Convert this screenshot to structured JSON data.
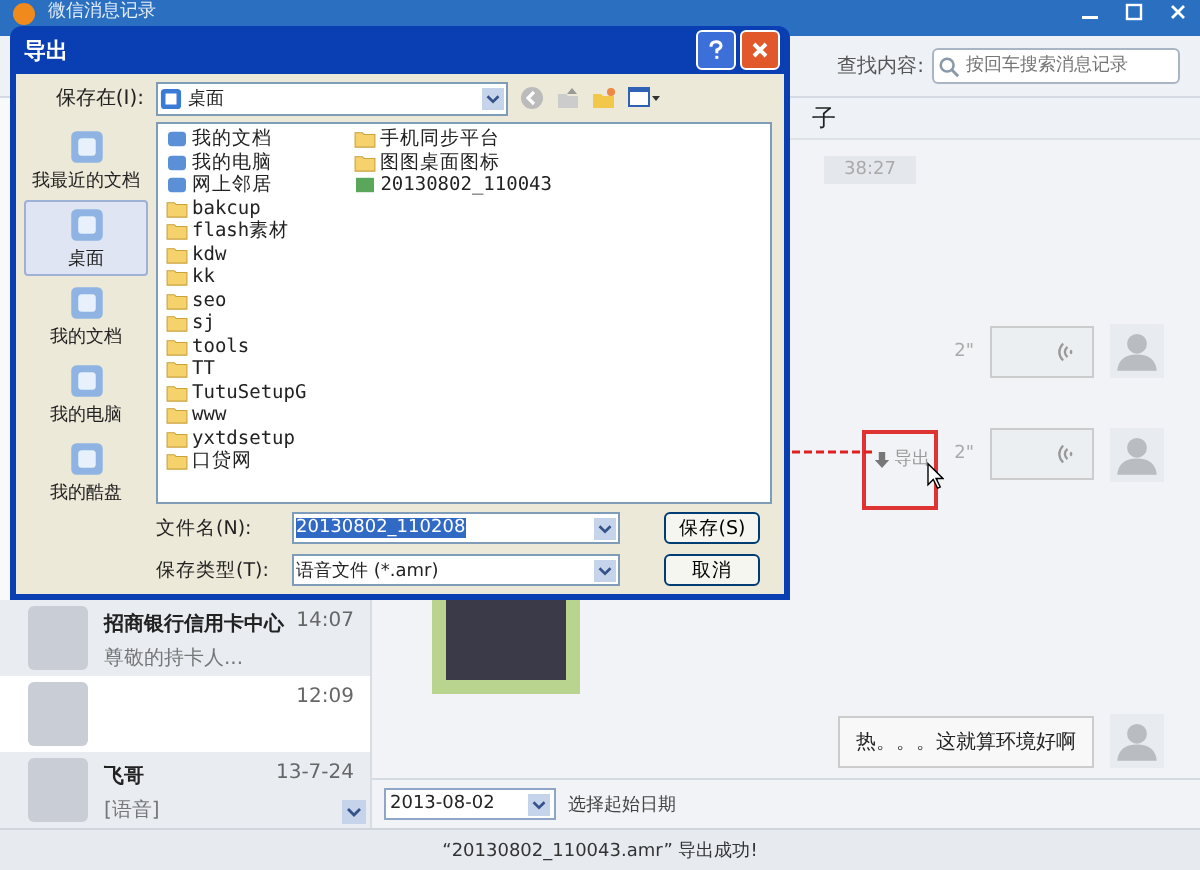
{
  "window": {
    "title": "微信消息记录"
  },
  "search": {
    "label": "查找内容:",
    "placeholder": "按回车搜索消息记录"
  },
  "contacts": [
    {
      "name": "招商银行信用卡中心",
      "time": "14:07",
      "preview": "尊敬的持卡人...",
      "selected": false
    },
    {
      "time": "12:09",
      "selected": true
    },
    {
      "name": "飞哥",
      "time": "13-7-24",
      "preview": "[语音]",
      "selected": false
    }
  ],
  "chat": {
    "title": "子",
    "timestamp": "38:27",
    "messages": [
      {
        "kind": "voice",
        "duration": "2\""
      },
      {
        "kind": "voice",
        "duration": "2\"",
        "hover_action": "导出"
      },
      {
        "kind": "image"
      },
      {
        "kind": "text",
        "text": "热。。。这就算环境好啊"
      }
    ]
  },
  "date_filter": {
    "value": "2013-08-02",
    "label": "选择起始日期"
  },
  "status_bar": "“20130802_110043.amr” 导出成功!",
  "dialog": {
    "title": "导出",
    "save_in_label": "保存在(I):",
    "save_in": "桌面",
    "places": [
      {
        "label": "我最近的文档",
        "selected": false
      },
      {
        "label": "桌面",
        "selected": true
      },
      {
        "label": "我的文档",
        "selected": false
      },
      {
        "label": "我的电脑",
        "selected": false
      },
      {
        "label": "我的酷盘",
        "selected": false
      }
    ],
    "files": [
      {
        "name": "我的文档",
        "kind": "docs"
      },
      {
        "name": "我的电脑",
        "kind": "computer"
      },
      {
        "name": "网上邻居",
        "kind": "network"
      },
      {
        "name": "bakcup",
        "kind": "folder"
      },
      {
        "name": "flash素材",
        "kind": "folder"
      },
      {
        "name": "kdw",
        "kind": "folder"
      },
      {
        "name": "kk",
        "kind": "folder"
      },
      {
        "name": "seo",
        "kind": "folder"
      },
      {
        "name": "sj",
        "kind": "folder"
      },
      {
        "name": "tools",
        "kind": "folder"
      },
      {
        "name": "TT",
        "kind": "folder"
      },
      {
        "name": "TutuSetupG",
        "kind": "folder"
      },
      {
        "name": "www",
        "kind": "folder"
      },
      {
        "name": "yxtdsetup",
        "kind": "folder"
      },
      {
        "name": "口贷网",
        "kind": "folder"
      },
      {
        "name": "手机同步平台",
        "kind": "folder"
      },
      {
        "name": "图图桌面图标",
        "kind": "folder"
      },
      {
        "name": "20130802_110043",
        "kind": "audio"
      }
    ],
    "filename_label": "文件名(N):",
    "filename": "20130802_110208",
    "filetype_label": "保存类型(T):",
    "filetype": "语音文件 (*.amr)",
    "buttons": [
      "保存(S)",
      "取消"
    ]
  }
}
